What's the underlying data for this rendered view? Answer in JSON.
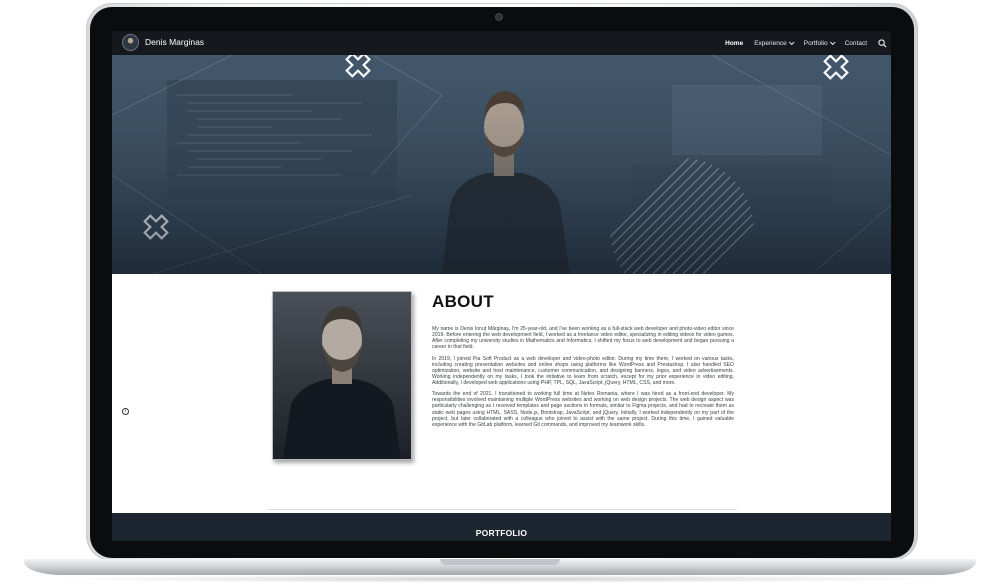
{
  "brand": {
    "name": "Denis Marginas"
  },
  "nav": {
    "items": [
      {
        "label": "Home",
        "active": true
      },
      {
        "label": "Experience",
        "dropdown": true
      },
      {
        "label": "Portfolio",
        "dropdown": true
      },
      {
        "label": "Contact"
      }
    ],
    "search_icon": "search-icon"
  },
  "about": {
    "title": "ABOUT",
    "paragraphs": [
      "My name is Denis Ionuț Mărginaș, I'm 25-year-old, and I've been working as a full-stack web developer and photo-video editor since 2019. Before entering the web development field, I worked as a freelance video editor, specializing in editing videos for video games. After completing my university studies in Mathematics and Informatics, I shifted my focus to web development and began pursuing a career in that field.",
      "In 2019, I joined Pia Soft Product as a web developer and video-photo editor. During my time there, I worked on various tasks, including creating presentation websites and online shops using platforms like WordPress and Prestashop. I also handled SEO optimization, website and host maintenance, customer communication, and designing banners, logos, and video advertisements. Working independently on my tasks, I took the initiative to learn from scratch, except for my prior experience in video editing. Additionally, I developed web applications using PHP, TPL, SQL, JavaScript, jQuery, HTML, CSS, and more.",
      "Towards the end of 2021, I transitioned to working full time at Netex Romania, where I was hired as a front-end developer. My responsibilities involved maintaining multiple WordPress websites and working on web design projects. The web design aspect was particularly challenging as I received templates and page sections in formats, similar to Figma projects, and had to recreate them as static web pages using HTML, SASS, Node.js, Bootstrap, JavaScript, and jQuery. Initially, I worked independently on my part of the project, but later collaborated with a colleague who joined to assist with the same project. During this time, I gained valuable experience with the GitLab platform, learned Git commands, and improved my teamwork skills."
    ]
  },
  "portfolio": {
    "title": "PORTFOLIO"
  },
  "colors": {
    "nav_bg": "#15181c",
    "hero_bg": "#3a4d60",
    "portfolio_bg": "#1c2530"
  }
}
